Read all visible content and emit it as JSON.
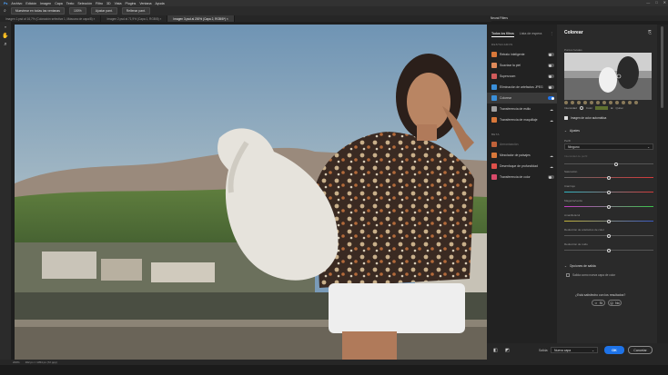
{
  "menu": [
    "Archivo",
    "Edición",
    "Imagen",
    "Capa",
    "Texto",
    "Selección",
    "Filtro",
    "3D",
    "Vista",
    "Plugins",
    "Ventana",
    "Ayuda"
  ],
  "window_controls": [
    "—",
    "□",
    "✕"
  ],
  "options_bar": {
    "sample_all": "Muestrear en todas las ventanas",
    "zoom": "100%",
    "fit": "Ajustar pant.",
    "fill": "Rellenar pant."
  },
  "doc_tabs": [
    {
      "label": "Imagen 1.psd al 16,7% (Coloración selectiva 1, Máscara de capa/8) ×",
      "active": false
    },
    {
      "label": "Imagen 2.psd al 71,9% (Capa 1, RGB/8) ×",
      "active": false
    },
    {
      "label": "Imagen 3.psd al 200% (Capa 2, RGB/8*) ×",
      "active": true
    }
  ],
  "status": {
    "zoom": "200%",
    "info": "462 px × 1054 px (72 ppp)"
  },
  "panel_title": "Neural Filters",
  "list": {
    "tabs": [
      "Todos los filtros",
      "Lista de espera"
    ],
    "featured_header": "DESTACADOS",
    "featured": [
      {
        "name": "Retrato inteligente",
        "icon_color": "#d9783a",
        "state": "off"
      },
      {
        "name": "Suavizar la piel",
        "icon_color": "#e08a5a",
        "state": "off"
      },
      {
        "name": "Superzoom",
        "icon_color": "#d15b5b",
        "state": "off"
      },
      {
        "name": "Eliminación de artefactos JPEG",
        "icon_color": "#3a8fd9",
        "state": "off"
      },
      {
        "name": "Colorear",
        "icon_color": "#3a8fd9",
        "state": "on"
      },
      {
        "name": "Transferencia de estilo",
        "icon_color": "#a0a0a0",
        "state": "cloud"
      },
      {
        "name": "Transferencia de maquillaje",
        "icon_color": "#d9783a",
        "state": "cloud"
      }
    ],
    "beta_header": "BETA",
    "beta": [
      {
        "name": "Armonización",
        "icon_color": "#c0623a",
        "state": "disabled"
      },
      {
        "name": "Mezclador de paisajes",
        "icon_color": "#d9783a",
        "state": "cloud"
      },
      {
        "name": "Desenfoque de profundidad",
        "icon_color": "#e0504a",
        "state": "cloud"
      },
      {
        "name": "Transferencia de color",
        "icon_color": "#d94a6a",
        "state": "off"
      }
    ]
  },
  "settings": {
    "title": "Colorear",
    "focus_label": "Puntos focales",
    "preview_labels": [
      "Intensidad",
      "Color",
      "Quitar"
    ],
    "auto_color_label": "Imagen de color automática",
    "adjustments_header": "Ajustes",
    "profile_label": "Perfil",
    "profile_value": "Ninguno",
    "profile_strength_label": "Intensidad de perfil",
    "sliders": [
      {
        "label": "Saturación",
        "value": 0
      },
      {
        "label": "Cian/rojo",
        "value": 0
      },
      {
        "label": "Magenta/verde",
        "value": 0
      },
      {
        "label": "Amarillo/azul",
        "value": 0
      },
      {
        "label": "Reducción de artefactos de color",
        "value": 0
      },
      {
        "label": "Reducción de ruido",
        "value": 0
      }
    ],
    "output_header": "Opciones de salida",
    "output_checkbox": "Salida como nueva capa de color",
    "feedback_question": "¿Está satisfecho con los resultados?",
    "yes": "Sí",
    "no": "No"
  },
  "footer": {
    "output_label": "Salida:",
    "output_value": "Nueva capa",
    "ok": "OK",
    "cancel": "Cancelar"
  },
  "colors": {
    "accent": "#1e73e8",
    "panel": "#2a2a2a",
    "list": "#222222"
  }
}
